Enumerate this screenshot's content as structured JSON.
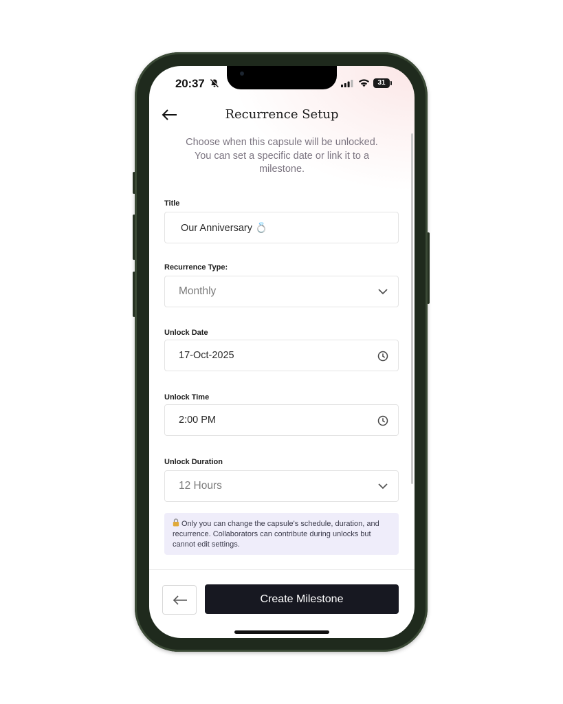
{
  "status_bar": {
    "time": "20:37",
    "battery": "31",
    "icons": [
      "bell-slash-icon",
      "signal-icon",
      "wifi-icon",
      "battery-icon"
    ]
  },
  "header": {
    "back_icon": "arrow-left-icon",
    "title": "Recurrence Setup",
    "subtitle": "Choose when this capsule will be unlocked. You can set a specific date or link it to a milestone."
  },
  "form": {
    "title": {
      "label": "Title",
      "value": "Our Anniversary 💍"
    },
    "recurrence_type": {
      "label": "Recurrence Type:",
      "value": "Monthly",
      "icon": "chevron-down-icon"
    },
    "unlock_date": {
      "label": "Unlock Date",
      "value": "17-Oct-2025",
      "icon": "clock-icon"
    },
    "unlock_time": {
      "label": "Unlock Time",
      "value": "2:00 PM",
      "icon": "clock-icon"
    },
    "unlock_duration": {
      "label": "Unlock Duration",
      "value": "12 Hours",
      "icon": "chevron-down-icon"
    }
  },
  "info_banner": {
    "icon": "lock-icon",
    "text": "Only you can change the capsule's schedule, duration, and recurrence. Collaborators can contribute during unlocks but cannot edit settings."
  },
  "footer": {
    "back_icon": "arrow-left-icon",
    "primary_label": "Create Milestone"
  },
  "colors": {
    "primary_button": "#171821",
    "banner_bg": "#efedfa",
    "phone_frame": "#1f2a1d"
  }
}
